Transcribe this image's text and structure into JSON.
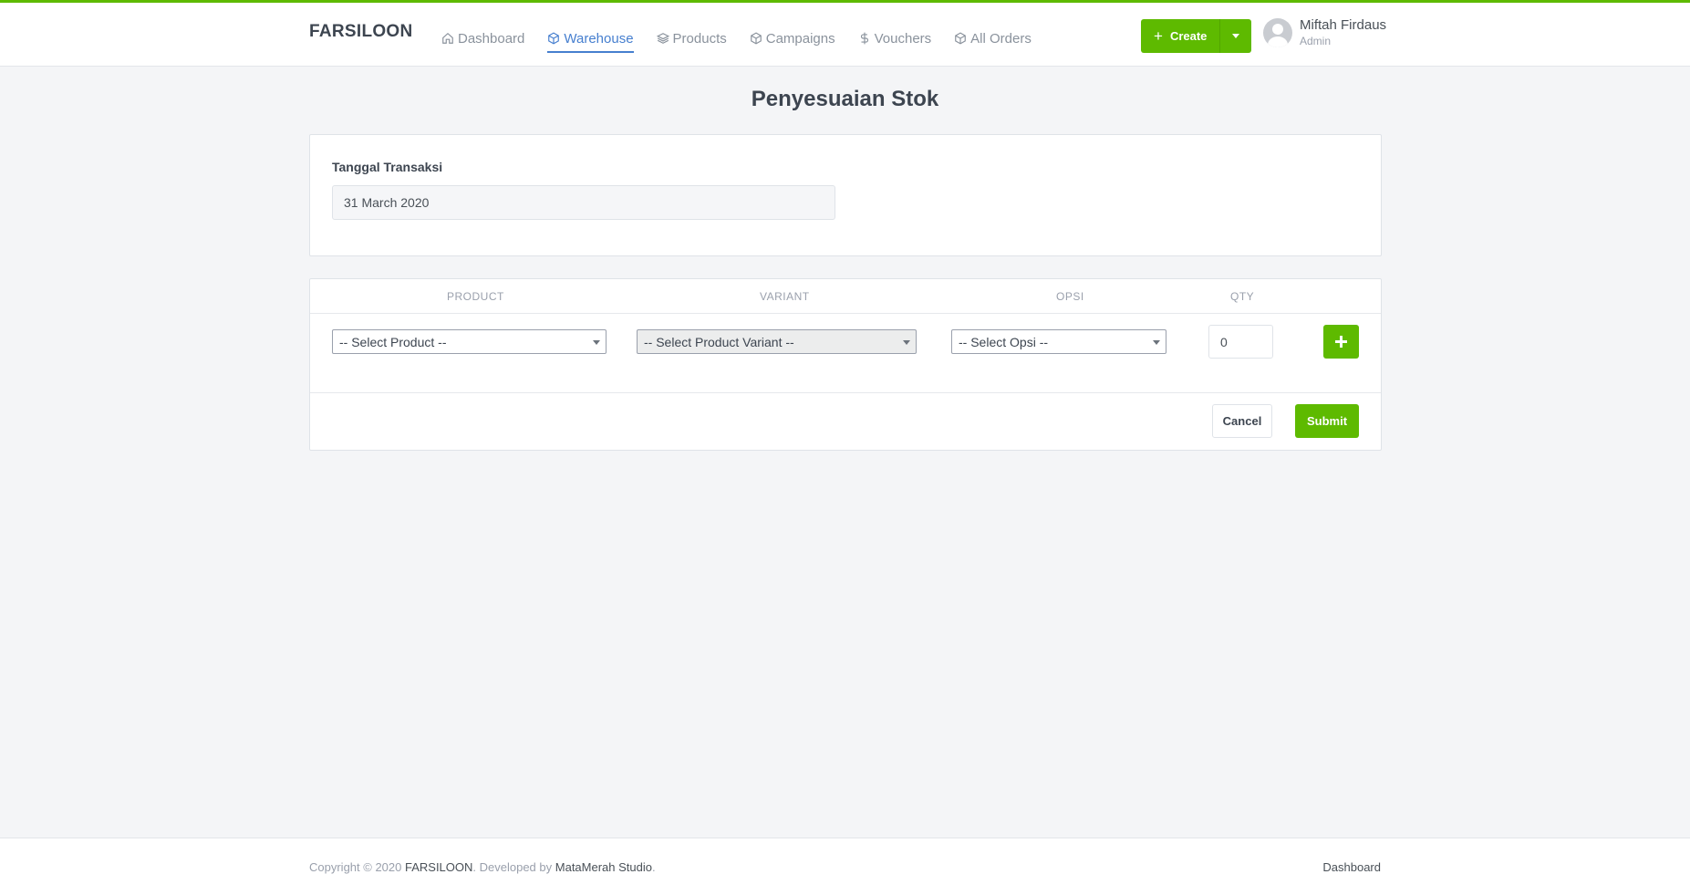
{
  "brand": "FARSILOON",
  "nav": [
    {
      "label": "Dashboard",
      "icon": "home-icon",
      "active": false
    },
    {
      "label": "Warehouse",
      "icon": "box-icon",
      "active": true
    },
    {
      "label": "Products",
      "icon": "layers-icon",
      "active": false
    },
    {
      "label": "Campaigns",
      "icon": "box-icon",
      "active": false
    },
    {
      "label": "Vouchers",
      "icon": "dollar-icon",
      "active": false
    },
    {
      "label": "All Orders",
      "icon": "box-icon",
      "active": false
    }
  ],
  "create": {
    "label": "Create",
    "plus": "+"
  },
  "user": {
    "name": "Miftah Firdaus",
    "role": "Admin"
  },
  "page_title": "Penyesuaian Stok",
  "form": {
    "date_label": "Tanggal Transaksi",
    "date_value": "31 March 2020"
  },
  "table": {
    "headers": [
      "PRODUCT",
      "VARIANT",
      "OPSI",
      "QTY"
    ],
    "row": {
      "product": "-- Select Product --",
      "variant": "-- Select Product Variant --",
      "opsi": "-- Select Opsi --",
      "qty": "0"
    }
  },
  "actions": {
    "cancel": "Cancel",
    "submit": "Submit"
  },
  "footer": {
    "copyright_prefix": "Copyright © 2020",
    "brand": "FARSILOON",
    "developed_by": ". Developed by",
    "studio": "MataMerah Studio",
    "period": ".",
    "link": "Dashboard"
  },
  "colors": {
    "accent": "#5eba00",
    "active_nav": "#467fcf"
  }
}
